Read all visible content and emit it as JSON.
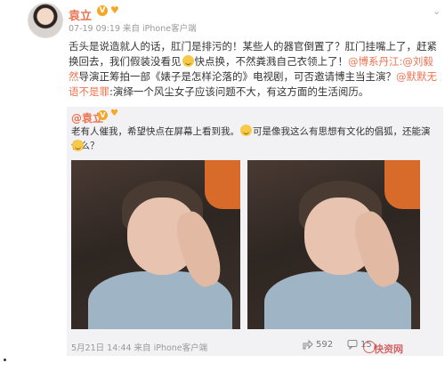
{
  "post": {
    "author": "袁立",
    "meta": "07-19 09:19 来自 iPhone客户端",
    "text": {
      "p1": "舌头是说造就人的话，肛门是排污的！某些人的器官倒置了？肛门挂嘴上了，赶紧换回去，我们假装没看见",
      "p2": "快点换，不然粪溅自己衣领上了",
      "link1": "@博系丹江:@刘毅然",
      "p3": "导演正筹拍一部《婊子是怎样沦落的》电视剧，可否邀请博主当主演？",
      "link2": "@",
      "link3": "默默无语不是罪",
      "p4": ":演绎一个风尘女子应该问题不大，有这方面的生活阅历。"
    }
  },
  "quoted": {
    "author": "@袁立",
    "text_a": "老有人催我，希望快点在屏幕上看到我。",
    "text_b": "可是像我这么有思想有文化的倡狐，还能演什么？"
  },
  "footer": {
    "date": "5月21日 14:44 来自 iPhone客户端",
    "shares": "592",
    "comments": "15"
  },
  "watermark": "快资网",
  "icons": [
    "verified-badge-icon",
    "heart-badge-icon",
    "chevron-down-icon",
    "share-icon",
    "comment-icon",
    "emoji-icon"
  ]
}
